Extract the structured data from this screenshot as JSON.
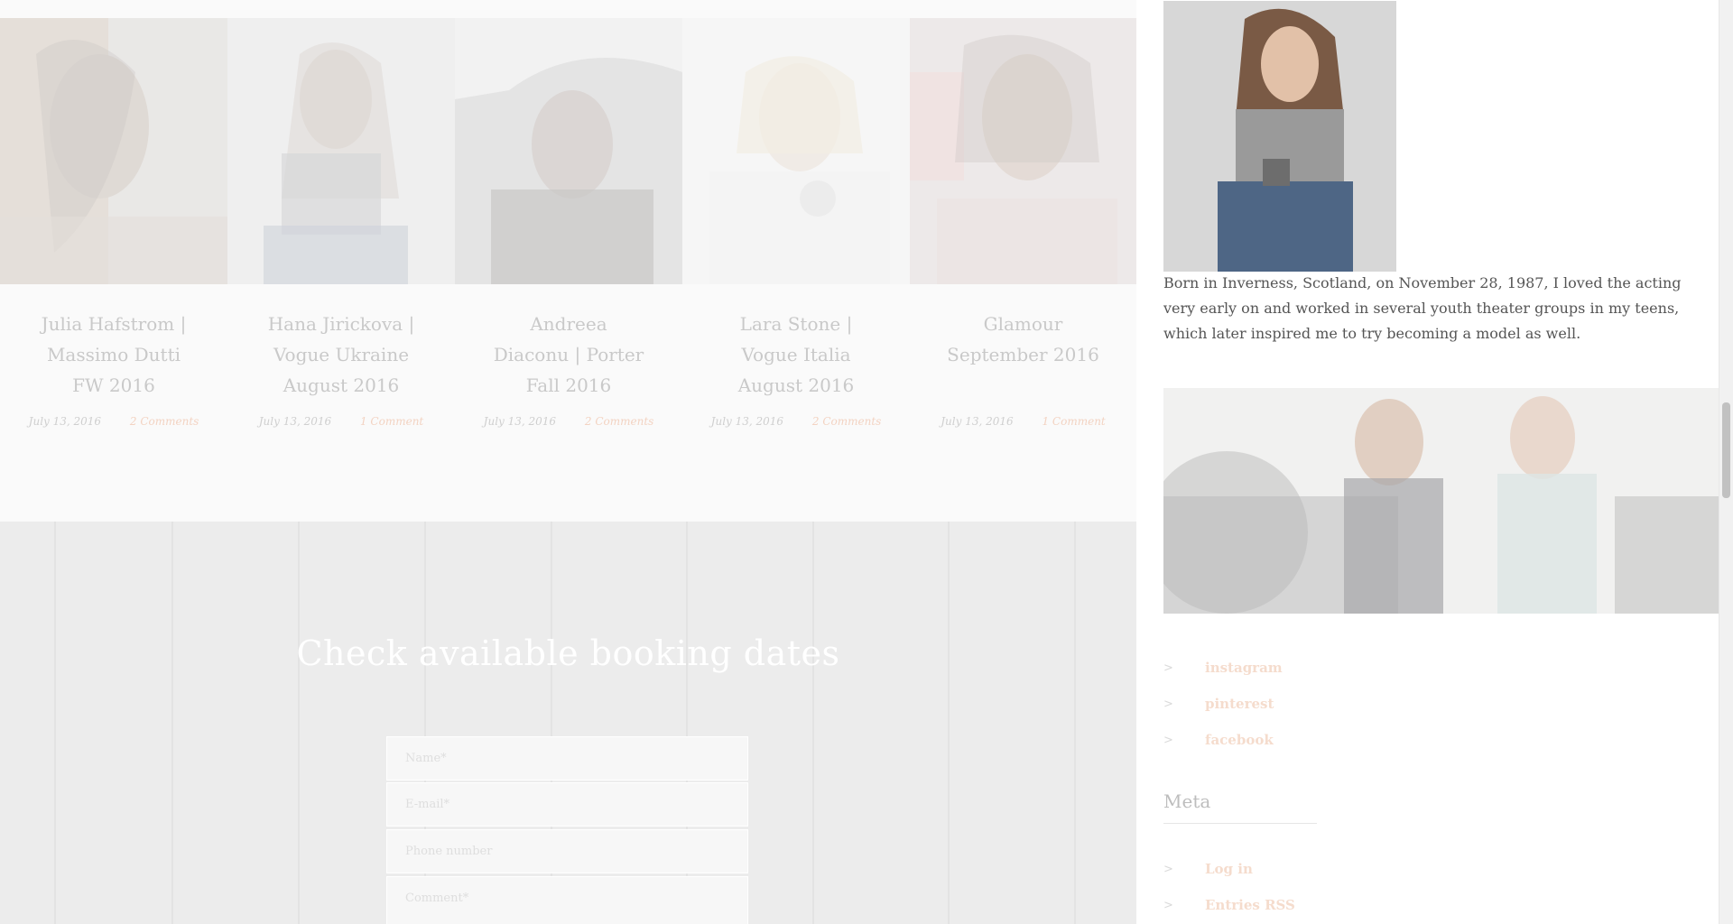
{
  "posts": [
    {
      "title": "Julia Hafstrom |\nMassimo Dutti\nFW 2016",
      "date": "July 13, 2016",
      "comments": "2 Comments"
    },
    {
      "title": "Hana Jirickova |\nVogue Ukraine\nAugust 2016",
      "date": "July 13, 2016",
      "comments": "1 Comment"
    },
    {
      "title": "Andreea\nDiaconu | Porter\nFall 2016",
      "date": "July 13, 2016",
      "comments": "2 Comments"
    },
    {
      "title": "Lara Stone |\nVogue Italia\nAugust 2016",
      "date": "July 13, 2016",
      "comments": "2 Comments"
    },
    {
      "title": "Glamour\nSeptember 2016",
      "date": "July 13, 2016",
      "comments": "1 Comment"
    }
  ],
  "booking": {
    "title": "Check available booking dates",
    "fields": [
      {
        "placeholder": "Name*"
      },
      {
        "placeholder": "E-mail*"
      },
      {
        "placeholder": "Phone number"
      },
      {
        "placeholder": "Comment*"
      }
    ]
  },
  "sidebar": {
    "bio": "Born in Inverness, Scotland, on November 28, 1987, I loved the acting very early on and worked in several youth theater groups in my teens, which later inspired me to try becoming a model as well.",
    "social_links": [
      {
        "label": "instagram",
        "icon": "chevron-right-icon"
      },
      {
        "label": "pinterest",
        "icon": "chevron-right-icon"
      },
      {
        "label": "facebook",
        "icon": "chevron-right-icon"
      }
    ],
    "meta_heading": "Meta",
    "meta_links": [
      {
        "label": "Log in",
        "icon": "chevron-right-icon"
      },
      {
        "label": "Entries RSS",
        "icon": "chevron-right-icon"
      }
    ]
  },
  "colors": {
    "accent": "#f3d3c2",
    "booking_bg": "#ececec",
    "muted_text": "#c9c9c9"
  }
}
